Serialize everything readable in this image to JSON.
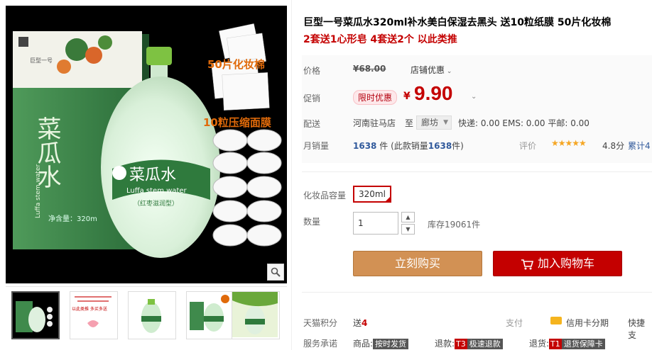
{
  "product": {
    "title": "巨型一号菜瓜水320ml补水美白保湿去黑头 送10粒纸膜 50片化妆棉",
    "promo_line": "2套送1心形皂 4套送2个 以此类推"
  },
  "images": {
    "brand_logo": "巨型一号",
    "product_cn_name": "菜瓜水",
    "product_en_name": "Luffa stem water",
    "box_volume": "净含量：320m",
    "bottle_sub": "（红枣滋润型）",
    "badge_cotton": "50片化妆棉",
    "badge_mask": "10粒压缩面膜",
    "thumb2_text": [
      "以此类推 多买多送"
    ]
  },
  "price": {
    "label": "价格",
    "original": "¥68.00",
    "shop_discount": "店铺优惠",
    "promo_label": "促销",
    "promo_tag": "限时优惠",
    "currency": "¥",
    "current": "9.90"
  },
  "delivery": {
    "label": "配送",
    "from": "河南驻马店",
    "to_label": "至",
    "to": "廊坊",
    "fees": "快递: 0.00 EMS: 0.00 平邮: 0.00"
  },
  "sales": {
    "label": "月销量",
    "count": "1638",
    "unit": "件",
    "detail_prefix": "(此款销量",
    "detail_count": "1638",
    "detail_suffix": "件)",
    "rating_label": "评价",
    "stars": "★★★★★",
    "score": "4.8分",
    "cumulative": "累计4"
  },
  "spec": {
    "label": "化妆品容量",
    "option": "320ml"
  },
  "quantity": {
    "label": "数量",
    "value": "1",
    "stock": "库存19061件"
  },
  "actions": {
    "buy_now": "立刻购买",
    "add_cart": "加入购物车"
  },
  "footer": {
    "points_label": "天猫积分",
    "points_prefix": "送",
    "points_value": "4",
    "pay_label": "支付",
    "credit": "信用卡分期",
    "fast": "快捷支",
    "promise_label": "服务承诺",
    "goods_label": "商品:",
    "goods_badge": "按时发货",
    "refund_label": "退款:",
    "refund_code": "T3",
    "refund_badge": "极速退款",
    "return_label": "退货:",
    "return_code": "T1",
    "return_badge": "退货保障卡"
  },
  "colors": {
    "price_red": "#c40000",
    "buy_orange": "#d29154",
    "link_blue": "#315a9c",
    "product_green": "#2f7a3d"
  }
}
